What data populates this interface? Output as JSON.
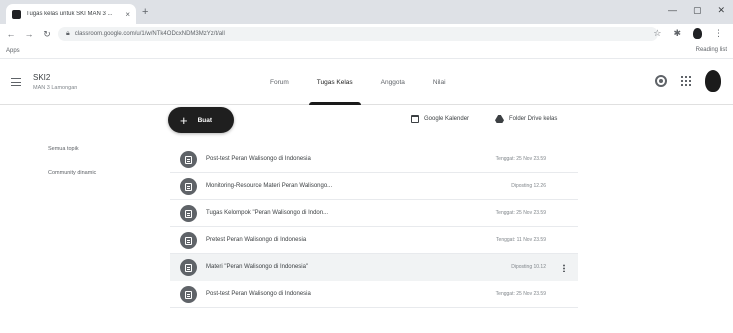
{
  "browser": {
    "tab_title": "Tugas kelas untuk SKI MAN 3 ...",
    "tab_close": "×",
    "new_tab": "+",
    "window_controls": [
      "—",
      "▢",
      "✕"
    ],
    "url": "classroom.google.com/u/1/w/NTk4ODcxNDM3MzYz/t/all",
    "bookmarks_apps": "Apps",
    "reading_list": "Reading list"
  },
  "appbar": {
    "class_name": "SKI2",
    "class_section": "MAN 3 Lamongan",
    "tabs": [
      {
        "label": "Forum",
        "active": false
      },
      {
        "label": "Tugas Kelas",
        "active": true
      },
      {
        "label": "Anggota",
        "active": false
      },
      {
        "label": "Nilai",
        "active": false
      }
    ]
  },
  "classwork": {
    "create_label": "Buat",
    "calendar_label": "Google Kalender",
    "drive_label": "Folder Drive kelas",
    "sidebar": [
      "Semua topik",
      "Community dinamic"
    ],
    "items": [
      {
        "title": "Post-test Peran Walisongo di Indonesia",
        "meta": "Tenggat: 25 Nov 23.59",
        "kind": "assignment"
      },
      {
        "title": "Monitoring-Resource Materi Peran Walisongo...",
        "meta": "Diposting 12.26",
        "kind": "assignment"
      },
      {
        "title": "Tugas Kelompok \"Peran Walisongo di Indon...",
        "meta": "Tenggat: 25 Nov 23.59",
        "kind": "assignment"
      },
      {
        "title": "Pretest Peran Walisongo di Indonesia",
        "meta": "Tenggat: 11 Nov 23.59",
        "kind": "assignment"
      },
      {
        "title": "Materi \"Peran Walisongo di Indonesia\"",
        "meta": "Diposting 10.12",
        "kind": "material"
      },
      {
        "title": "Post-test Peran Walisongo di Indonesia",
        "meta": "Tenggat: 25 Nov 23.59",
        "kind": "assignment"
      }
    ]
  },
  "icons": {
    "menu": "menu-icon",
    "settings": "gear-icon",
    "apps": "apps-grid-icon",
    "calendar": "calendar-icon",
    "drive": "drive-icon",
    "assignment": "assignment-icon",
    "material": "material-icon",
    "more": "more-vert-icon"
  },
  "colors": {
    "accent": "#1f1f1f",
    "highlight_row": "#f1f3f4",
    "icon_circle": "#5f6368"
  }
}
